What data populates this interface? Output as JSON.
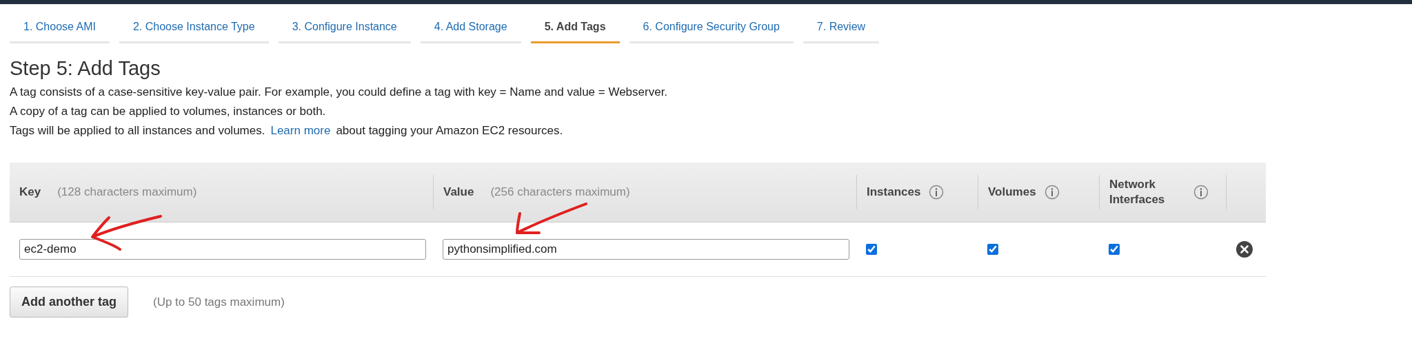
{
  "tabs": [
    {
      "label": "1. Choose AMI",
      "selected": false
    },
    {
      "label": "2. Choose Instance Type",
      "selected": false
    },
    {
      "label": "3. Configure Instance",
      "selected": false
    },
    {
      "label": "4. Add Storage",
      "selected": false
    },
    {
      "label": "5. Add Tags",
      "selected": true
    },
    {
      "label": "6. Configure Security Group",
      "selected": false
    },
    {
      "label": "7. Review",
      "selected": false
    }
  ],
  "heading": "Step 5: Add Tags",
  "intro": [
    "A tag consists of a case-sensitive key-value pair. For example, you could define a tag with key = Name and value = Webserver.",
    "A copy of a tag can be applied to volumes, instances or both."
  ],
  "learn_line": {
    "before": "Tags will be applied to all instances and volumes.",
    "link": "Learn more",
    "after": "about tagging your Amazon EC2 resources."
  },
  "table": {
    "columns": [
      {
        "kind": "text",
        "label": "Key",
        "hint": "(128 characters maximum)"
      },
      {
        "kind": "text",
        "label": "Value",
        "hint": "(256 characters maximum)"
      },
      {
        "kind": "check",
        "label": "Instances"
      },
      {
        "kind": "check",
        "label": "Volumes"
      },
      {
        "kind": "check",
        "label": "Network Interfaces"
      }
    ],
    "rows": [
      {
        "key": "ec2-demo",
        "value": "pythonsimplified.com",
        "instances": true,
        "volumes": true,
        "network_interfaces": true
      }
    ]
  },
  "add_button": "Add another tag",
  "add_note": "(Up to 50 tags maximum)"
}
